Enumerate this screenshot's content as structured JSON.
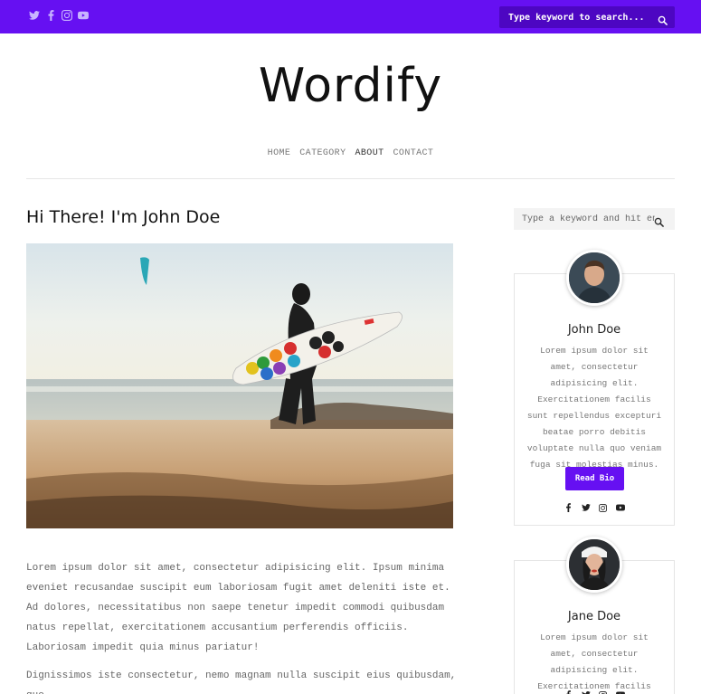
{
  "topbar": {
    "social_icons": [
      "twitter-icon",
      "facebook-icon",
      "instagram-icon",
      "youtube-icon"
    ],
    "search_placeholder": "Type keyword to search..."
  },
  "site": {
    "logo": "Wordify"
  },
  "nav": {
    "home": "HOME",
    "category": "CATEGORY",
    "about": "ABOUT",
    "contact": "CONTACT",
    "active": "ABOUT"
  },
  "post": {
    "title": "Hi There! I'm John Doe",
    "paragraph1": "Lorem ipsum dolor sit amet, consectetur adipisicing elit. Ipsum minima eveniet recusandae suscipit eum laboriosam fugit amet deleniti iste et. Ad dolores, necessitatibus non saepe tenetur impedit commodi quibusdam natus repellat, exercitationem accusantium perferendis officiis. Laboriosam impedit quia minus pariatur!",
    "paragraph2": "Dignissimos iste consectetur, nemo magnam nulla suscipit eius quibusdam, quo"
  },
  "sidebar": {
    "search_placeholder": "Type a keyword and hit enter",
    "bios": [
      {
        "name": "John Doe",
        "text": "Lorem ipsum dolor sit amet, consectetur adipisicing elit. Exercitationem facilis sunt repellendus excepturi beatae porro debitis voluptate nulla quo veniam fuga sit molestias minus.",
        "button": "Read Bio"
      },
      {
        "name": "Jane Doe",
        "text": "Lorem ipsum dolor sit amet, consectetur adipisicing elit. Exercitationem facilis sunt"
      }
    ]
  },
  "colors": {
    "brand": "#6610f2",
    "topbar_search_bg": "#4d06c2"
  }
}
